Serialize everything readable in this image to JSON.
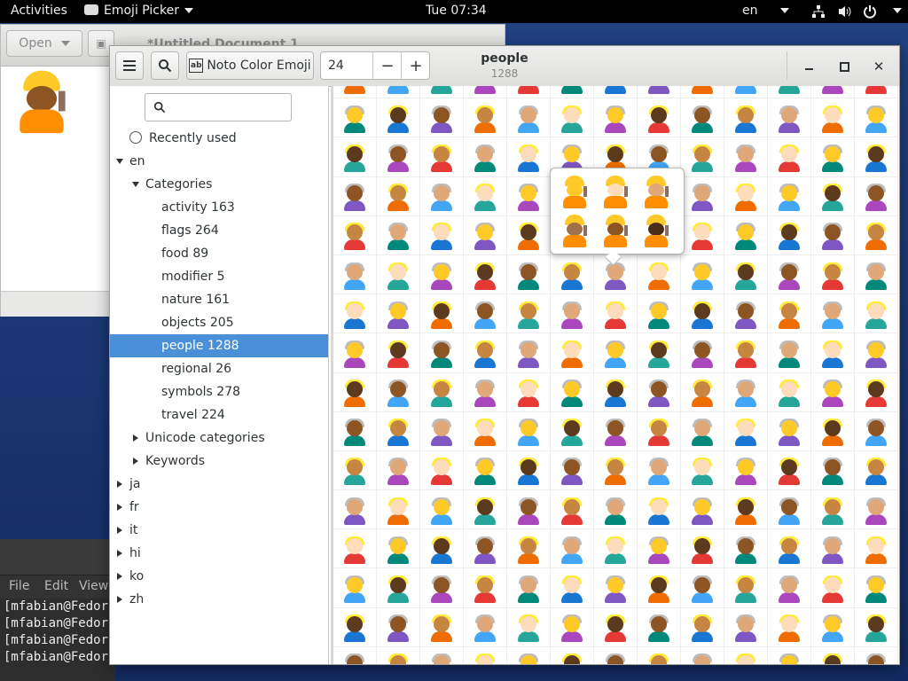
{
  "topbar": {
    "activities": "Activities",
    "app_menu": "Emoji Picker",
    "clock": "Tue 07:34",
    "input_source": "en"
  },
  "gedit": {
    "open_label": "Open",
    "title": "*Untitled Document 1",
    "save_label": "Save"
  },
  "terminal": {
    "menu": [
      "File",
      "Edit",
      "View"
    ],
    "lines": [
      "[mfabian@Fedor",
      "[mfabian@Fedor",
      "[mfabian@Fedor",
      "[mfabian@Fedor"
    ]
  },
  "header": {
    "font_button": "Noto Color Emoji",
    "font_size": "24",
    "title": "people",
    "subtitle": "1288"
  },
  "sidebar": {
    "search_placeholder": "",
    "recently_used": "Recently used",
    "en": "en",
    "categories": "Categories",
    "items": [
      {
        "label": "activity 163"
      },
      {
        "label": "flags 264"
      },
      {
        "label": "food 89"
      },
      {
        "label": "modifier 5"
      },
      {
        "label": "nature 161"
      },
      {
        "label": "objects 205"
      },
      {
        "label": "people 1288",
        "selected": true
      },
      {
        "label": "regional 26"
      },
      {
        "label": "symbols 278"
      },
      {
        "label": "travel 224"
      }
    ],
    "unicode_categories": "Unicode categories",
    "keywords": "Keywords",
    "languages": [
      "ja",
      "fr",
      "it",
      "hi",
      "ko",
      "zh"
    ]
  },
  "colors": {
    "selection": "#4a90d9",
    "helmet": "#ffca28",
    "vest": "#ff8f00",
    "desktop": "#1a3470"
  }
}
